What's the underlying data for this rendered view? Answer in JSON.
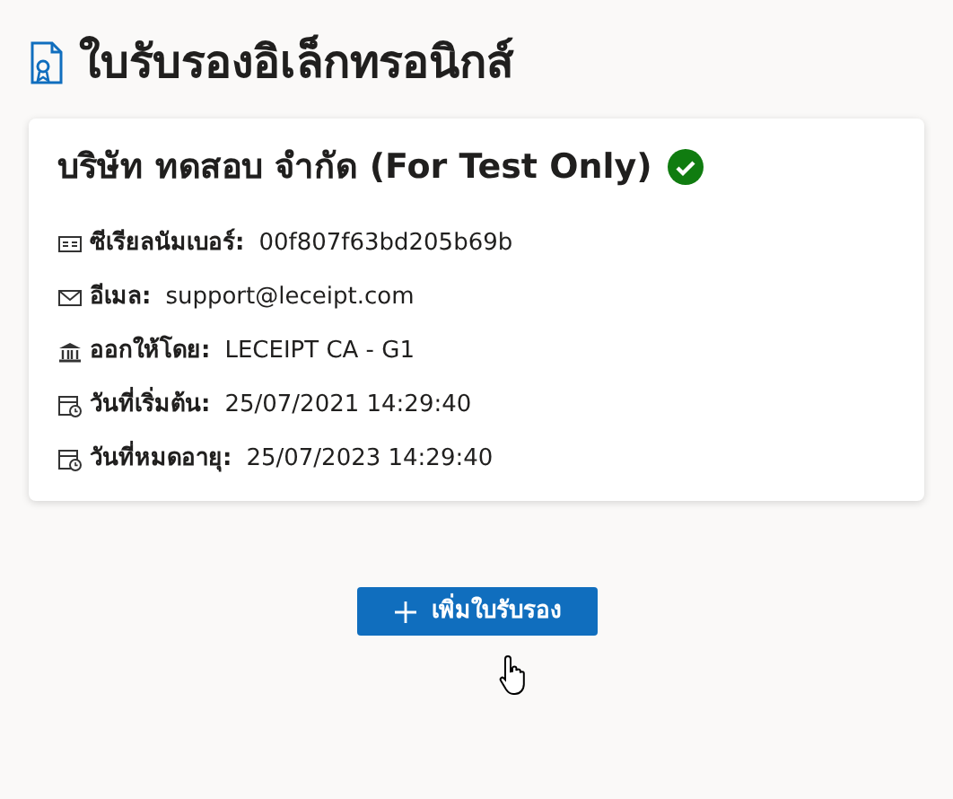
{
  "title": "ใบรับรองอิเล็กทรอนิกส์",
  "certificate": {
    "name": "บริษัท ทดสอบ จำกัด (For Test Only)",
    "verified": true,
    "details": [
      {
        "kind": "id",
        "label": "ซีเรียลนัมเบอร์:",
        "value": "00f807f63bd205b69b"
      },
      {
        "kind": "email",
        "label": "อีเมล:",
        "value": "support@leceipt.com"
      },
      {
        "kind": "issuer",
        "label": "ออกให้โดย:",
        "value": "LECEIPT CA - G1"
      },
      {
        "kind": "start",
        "label": "วันที่เริ่มต้น:",
        "value": "25/07/2021 14:29:40"
      },
      {
        "kind": "expiry",
        "label": "วันที่หมดอายุ:",
        "value": "25/07/2023 14:29:40"
      }
    ]
  },
  "add_button": {
    "label": "เพิ่มใบรับรอง"
  }
}
